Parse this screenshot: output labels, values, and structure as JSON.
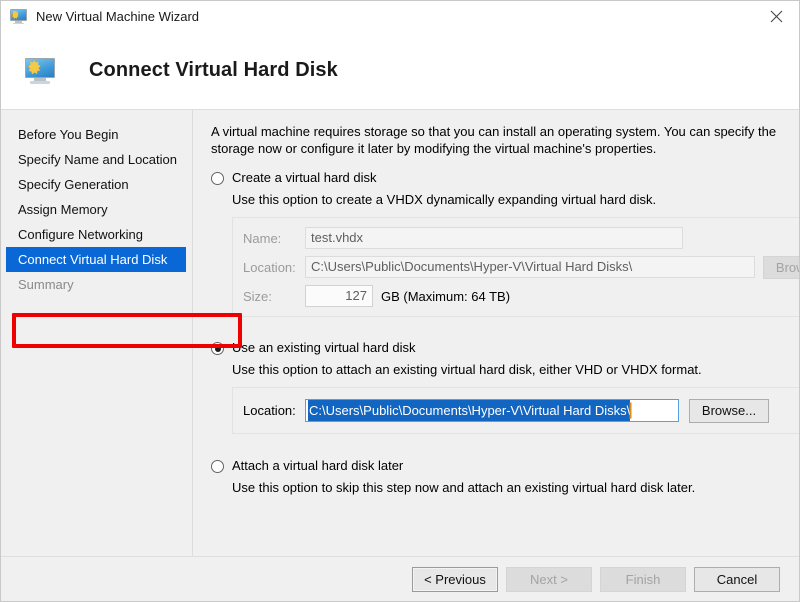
{
  "window": {
    "title": "New Virtual Machine Wizard",
    "icon": "virtual-machine-monitor-icon",
    "close_label": "×"
  },
  "header": {
    "title": "Connect Virtual Hard Disk",
    "icon": "virtual-machine-monitor-icon"
  },
  "sidebar": {
    "items": [
      {
        "label": "Before You Begin",
        "state": "normal"
      },
      {
        "label": "Specify Name and Location",
        "state": "normal"
      },
      {
        "label": "Specify Generation",
        "state": "normal"
      },
      {
        "label": "Assign Memory",
        "state": "normal"
      },
      {
        "label": "Configure Networking",
        "state": "normal"
      },
      {
        "label": "Connect Virtual Hard Disk",
        "state": "active"
      },
      {
        "label": "Summary",
        "state": "disabled"
      }
    ],
    "active_color": "#0a68d6"
  },
  "content": {
    "intro": "A virtual machine requires storage so that you can install an operating system. You can specify the storage now or configure it later by modifying the virtual machine's properties.",
    "options": [
      {
        "id": "create-virtual-hard-disk",
        "label": "Create a virtual hard disk",
        "description": "Use this option to create a VHDX dynamically expanding virtual hard disk.",
        "selected": false
      },
      {
        "id": "use-existing-virtual-hard-disk",
        "label": "Use an existing virtual hard disk",
        "description": "Use this option to attach an existing virtual hard disk, either VHD or VHDX format.",
        "selected": true
      },
      {
        "id": "attach-virtual-hard-disk-later",
        "label": "Attach a virtual hard disk later",
        "description": "Use this option to skip this step now and attach an existing virtual hard disk later.",
        "selected": false
      }
    ],
    "create_fields": {
      "name_label": "Name:",
      "name_value": "test.vhdx",
      "location_label": "Location:",
      "location_value": "C:\\Users\\Public\\Documents\\Hyper-V\\Virtual Hard Disks\\",
      "browse_label": "Browse...",
      "size_label": "Size:",
      "size_value": "127",
      "size_suffix": "GB (Maximum: 64 TB)"
    },
    "existing_fields": {
      "location_label": "Location:",
      "location_value": "C:\\Users\\Public\\Documents\\Hyper-V\\Virtual Hard Disks\\",
      "browse_label": "Browse..."
    }
  },
  "annotation": {
    "color": "#ef0000",
    "target": "use-an-existing-virtual-hard-disk-radio"
  },
  "footer": {
    "buttons": [
      {
        "label": "< Previous",
        "enabled": true,
        "default": true
      },
      {
        "label": "Next >",
        "enabled": false,
        "default": false
      },
      {
        "label": "Finish",
        "enabled": false,
        "default": false
      },
      {
        "label": "Cancel",
        "enabled": true,
        "default": false
      }
    ]
  }
}
